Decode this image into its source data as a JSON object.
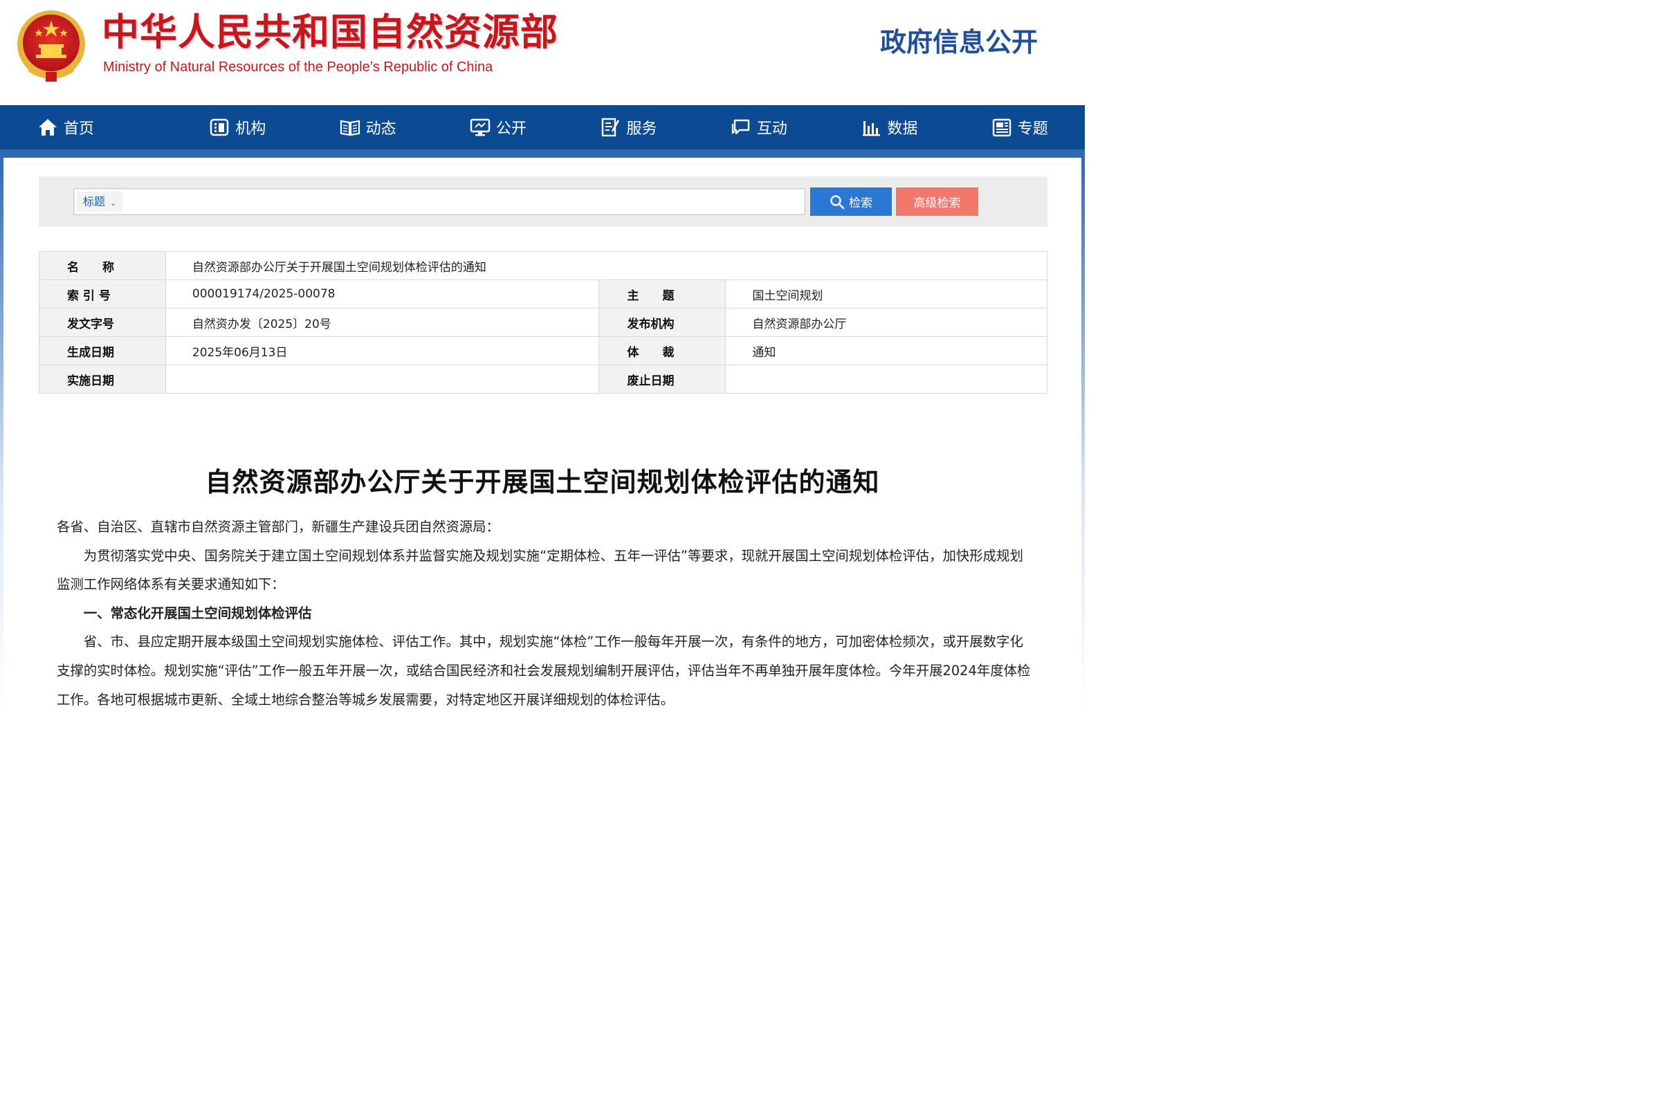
{
  "header": {
    "site_title": "中华人民共和国自然资源部",
    "site_subtitle": "Ministry of Natural Resources of the People’s Republic of China",
    "section_name": "政府信息公开",
    "colors": {
      "title_red": "#c8161d",
      "nav_blue": "#0d4a94",
      "section_blue": "#1f4f99"
    }
  },
  "nav": {
    "items": [
      {
        "label": "首页",
        "icon": "home-icon"
      },
      {
        "label": "机构",
        "icon": "org-icon"
      },
      {
        "label": "动态",
        "icon": "book-icon"
      },
      {
        "label": "公开",
        "icon": "monitor-icon"
      },
      {
        "label": "服务",
        "icon": "edit-doc-icon"
      },
      {
        "label": "互动",
        "icon": "chat-icon"
      },
      {
        "label": "数据",
        "icon": "bar-chart-icon"
      },
      {
        "label": "专题",
        "icon": "newspaper-icon"
      }
    ]
  },
  "search": {
    "field_label": "标题",
    "input_value": "",
    "search_button": "检索",
    "advanced_button": "高级检索"
  },
  "meta": {
    "name_label": "名　　称",
    "name_value": "自然资源部办公厅关于开展国土空间规划体检评估的通知",
    "index_label": "索 引 号",
    "index_value": "000019174/2025-00078",
    "topic_label": "主　　题",
    "topic_value": "国土空间规划",
    "docno_label": "发文字号",
    "docno_value": "自然资办发〔2025〕20号",
    "publisher_label": "发布机构",
    "publisher_value": "自然资源部办公厅",
    "created_label": "生成日期",
    "created_value": "2025年06月13日",
    "genre_label": "体　　裁",
    "genre_value": "通知",
    "effective_label": "实施日期",
    "effective_value": "",
    "abolished_label": "废止日期",
    "abolished_value": ""
  },
  "article": {
    "title": "自然资源部办公厅关于开展国土空间规划体检评估的通知",
    "addressee": "各省、自治区、直辖市自然资源主管部门，新疆生产建设兵团自然资源局：",
    "intro": "为贯彻落实党中央、国务院关于建立国土空间规划体系并监督实施及规划实施“定期体检、五年一评估”等要求，现就开展国土空间规划体检评估，加快形成规划监测工作网络体系有关要求通知如下：",
    "section1_heading": "一、常态化开展国土空间规划体检评估",
    "section1_body": "省、市、县应定期开展本级国土空间规划实施体检、评估工作。其中，规划实施“体检”工作一般每年开展一次，有条件的地方，可加密体检频次，或开展数字化支撑的实时体检。规划实施“评估”工作一般五年开展一次，或结合国民经济和社会发展规划编制开展评估，评估当年不再单独开展年度体检。今年开展2024年度体检工作。各地可根据城市更新、全域土地综合整治等城乡发展需要，对特定地区开展详细规划的体检评估。"
  }
}
